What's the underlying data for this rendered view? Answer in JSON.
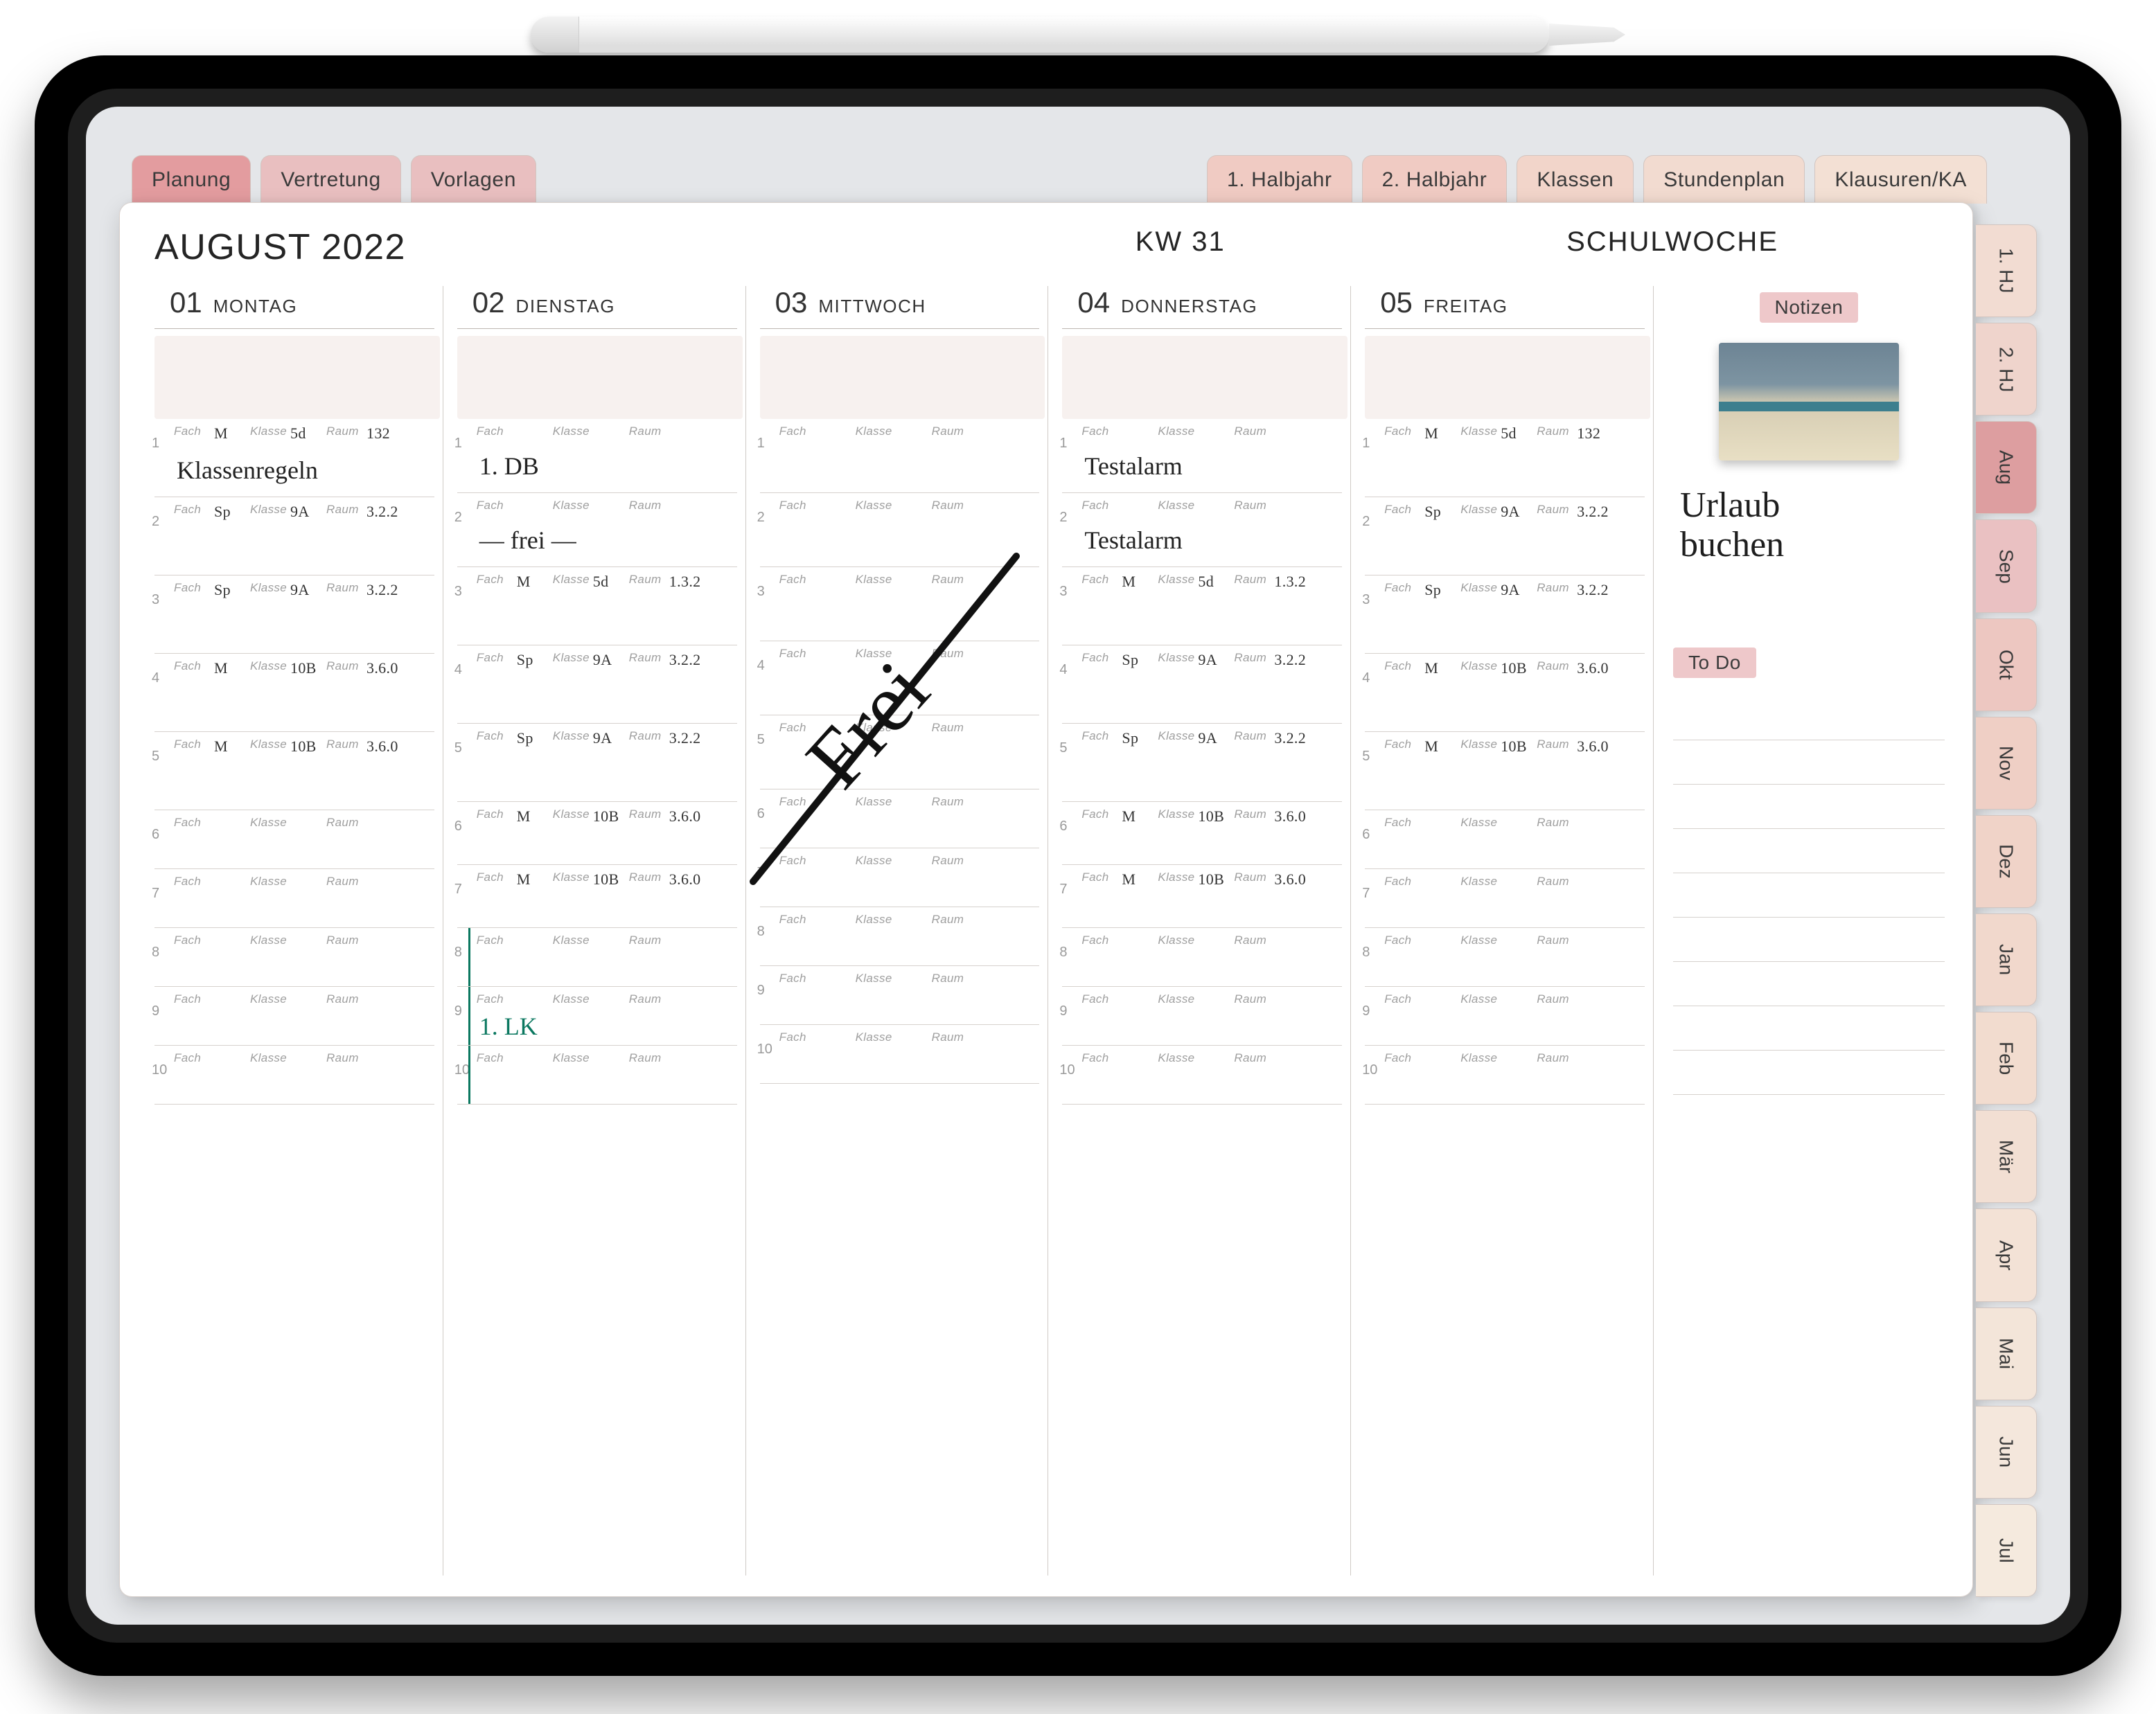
{
  "header": {
    "title": "AUGUST 2022",
    "week_label": "KW 31",
    "schoolweek_label": "SCHULWOCHE"
  },
  "top_tabs": [
    {
      "label": "Planung"
    },
    {
      "label": "Vertretung"
    },
    {
      "label": "Vorlagen"
    },
    {
      "label": "1. Halbjahr"
    },
    {
      "label": "2. Halbjahr"
    },
    {
      "label": "Klassen"
    },
    {
      "label": "Stundenplan"
    },
    {
      "label": "Klausuren/KA"
    }
  ],
  "side_tabs": [
    {
      "label": "1. HJ"
    },
    {
      "label": "2. HJ"
    },
    {
      "label": "Aug"
    },
    {
      "label": "Sep"
    },
    {
      "label": "Okt"
    },
    {
      "label": "Nov"
    },
    {
      "label": "Dez"
    },
    {
      "label": "Jan"
    },
    {
      "label": "Feb"
    },
    {
      "label": "Mär"
    },
    {
      "label": "Apr"
    },
    {
      "label": "Mai"
    },
    {
      "label": "Jun"
    },
    {
      "label": "Jul"
    }
  ],
  "slot_labels": {
    "fach": "Fach",
    "klasse": "Klasse",
    "raum": "Raum"
  },
  "days": [
    {
      "num": "01",
      "name": "MONTAG",
      "slots": [
        {
          "n": "1",
          "fach": "M",
          "klasse": "5d",
          "raum": "132",
          "note": "Klassenregeln"
        },
        {
          "n": "2",
          "fach": "Sp",
          "klasse": "9A",
          "raum": "3.2.2",
          "note": ""
        },
        {
          "n": "3",
          "fach": "Sp",
          "klasse": "9A",
          "raum": "3.2.2",
          "note": ""
        },
        {
          "n": "4",
          "fach": "M",
          "klasse": "10B",
          "raum": "3.6.0",
          "note": ""
        },
        {
          "n": "5",
          "fach": "M",
          "klasse": "10B",
          "raum": "3.6.0",
          "note": ""
        },
        {
          "n": "6",
          "fach": "",
          "klasse": "",
          "raum": "",
          "note": ""
        },
        {
          "n": "7",
          "fach": "",
          "klasse": "",
          "raum": "",
          "note": ""
        },
        {
          "n": "8",
          "fach": "",
          "klasse": "",
          "raum": "",
          "note": ""
        },
        {
          "n": "9",
          "fach": "",
          "klasse": "",
          "raum": "",
          "note": ""
        },
        {
          "n": "10",
          "fach": "",
          "klasse": "",
          "raum": "",
          "note": ""
        }
      ]
    },
    {
      "num": "02",
      "name": "DIENSTAG",
      "slots": [
        {
          "n": "1",
          "fach": "",
          "klasse": "",
          "raum": "",
          "note": "1. DB"
        },
        {
          "n": "2",
          "fach": "",
          "klasse": "",
          "raum": "",
          "note": "— frei —"
        },
        {
          "n": "3",
          "fach": "M",
          "klasse": "5d",
          "raum": "1.3.2",
          "note": ""
        },
        {
          "n": "4",
          "fach": "Sp",
          "klasse": "9A",
          "raum": "3.2.2",
          "note": ""
        },
        {
          "n": "5",
          "fach": "Sp",
          "klasse": "9A",
          "raum": "3.2.2",
          "note": ""
        },
        {
          "n": "6",
          "fach": "M",
          "klasse": "10B",
          "raum": "3.6.0",
          "note": ""
        },
        {
          "n": "7",
          "fach": "M",
          "klasse": "10B",
          "raum": "3.6.0",
          "note": ""
        },
        {
          "n": "8",
          "fach": "",
          "klasse": "",
          "raum": "",
          "note": ""
        },
        {
          "n": "9",
          "fach": "",
          "klasse": "",
          "raum": "",
          "note": "1. LK",
          "green": true
        },
        {
          "n": "10",
          "fach": "",
          "klasse": "",
          "raum": "",
          "note": ""
        }
      ],
      "green_rail_from": 8
    },
    {
      "num": "03",
      "name": "MITTWOCH",
      "big_free": "Frei",
      "slots": [
        {
          "n": "1",
          "fach": "",
          "klasse": "",
          "raum": "",
          "note": ""
        },
        {
          "n": "2",
          "fach": "",
          "klasse": "",
          "raum": "",
          "note": ""
        },
        {
          "n": "3",
          "fach": "",
          "klasse": "",
          "raum": "",
          "note": ""
        },
        {
          "n": "4",
          "fach": "",
          "klasse": "",
          "raum": "",
          "note": ""
        },
        {
          "n": "5",
          "fach": "",
          "klasse": "",
          "raum": "",
          "note": ""
        },
        {
          "n": "6",
          "fach": "",
          "klasse": "",
          "raum": "",
          "note": ""
        },
        {
          "n": "7",
          "fach": "",
          "klasse": "",
          "raum": "",
          "note": ""
        },
        {
          "n": "8",
          "fach": "",
          "klasse": "",
          "raum": "",
          "note": ""
        },
        {
          "n": "9",
          "fach": "",
          "klasse": "",
          "raum": "",
          "note": ""
        },
        {
          "n": "10",
          "fach": "",
          "klasse": "",
          "raum": "",
          "note": ""
        }
      ]
    },
    {
      "num": "04",
      "name": "DONNERSTAG",
      "slots": [
        {
          "n": "1",
          "fach": "",
          "klasse": "",
          "raum": "",
          "note": "Testalarm"
        },
        {
          "n": "2",
          "fach": "",
          "klasse": "",
          "raum": "",
          "note": "Testalarm"
        },
        {
          "n": "3",
          "fach": "M",
          "klasse": "5d",
          "raum": "1.3.2",
          "note": ""
        },
        {
          "n": "4",
          "fach": "Sp",
          "klasse": "9A",
          "raum": "3.2.2",
          "note": ""
        },
        {
          "n": "5",
          "fach": "Sp",
          "klasse": "9A",
          "raum": "3.2.2",
          "note": ""
        },
        {
          "n": "6",
          "fach": "M",
          "klasse": "10B",
          "raum": "3.6.0",
          "note": ""
        },
        {
          "n": "7",
          "fach": "M",
          "klasse": "10B",
          "raum": "3.6.0",
          "note": ""
        },
        {
          "n": "8",
          "fach": "",
          "klasse": "",
          "raum": "",
          "note": ""
        },
        {
          "n": "9",
          "fach": "",
          "klasse": "",
          "raum": "",
          "note": ""
        },
        {
          "n": "10",
          "fach": "",
          "klasse": "",
          "raum": "",
          "note": ""
        }
      ]
    },
    {
      "num": "05",
      "name": "FREITAG",
      "slots": [
        {
          "n": "1",
          "fach": "M",
          "klasse": "5d",
          "raum": "132",
          "note": ""
        },
        {
          "n": "2",
          "fach": "Sp",
          "klasse": "9A",
          "raum": "3.2.2",
          "note": ""
        },
        {
          "n": "3",
          "fach": "Sp",
          "klasse": "9A",
          "raum": "3.2.2",
          "note": ""
        },
        {
          "n": "4",
          "fach": "M",
          "klasse": "10B",
          "raum": "3.6.0",
          "note": ""
        },
        {
          "n": "5",
          "fach": "M",
          "klasse": "10B",
          "raum": "3.6.0",
          "note": ""
        },
        {
          "n": "6",
          "fach": "",
          "klasse": "",
          "raum": "",
          "note": ""
        },
        {
          "n": "7",
          "fach": "",
          "klasse": "",
          "raum": "",
          "note": ""
        },
        {
          "n": "8",
          "fach": "",
          "klasse": "",
          "raum": "",
          "note": ""
        },
        {
          "n": "9",
          "fach": "",
          "klasse": "",
          "raum": "",
          "note": ""
        },
        {
          "n": "10",
          "fach": "",
          "klasse": "",
          "raum": "",
          "note": ""
        }
      ]
    }
  ],
  "notes": {
    "heading": "Notizen",
    "handwritten": "Urlaub\nbuchen",
    "todo_heading": "To Do"
  }
}
